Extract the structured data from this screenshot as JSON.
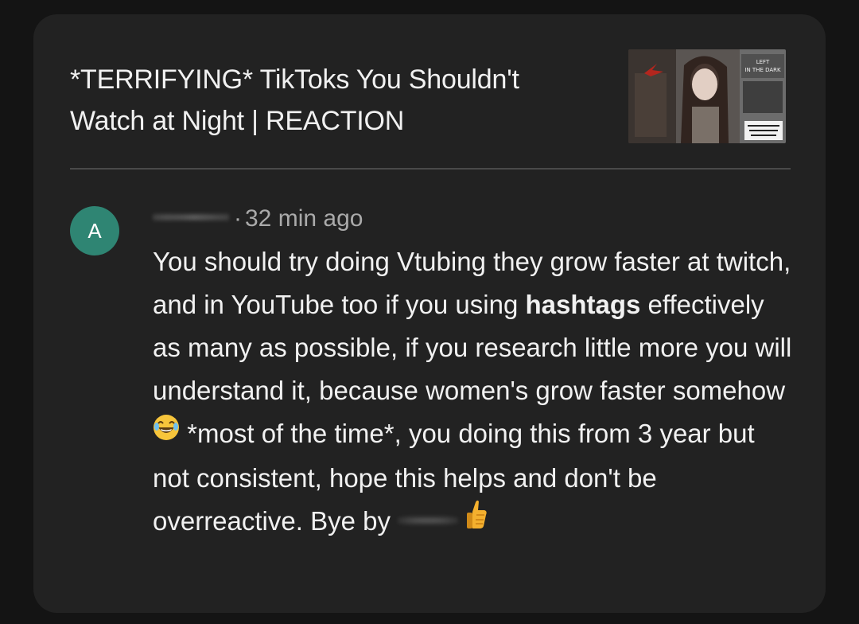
{
  "video": {
    "title_line1": "*TERRIFYING* TikToks You Shouldn't",
    "title_line2": "Watch at Night | REACTION",
    "thumbnail_icon": "video-thumbnail"
  },
  "comment": {
    "avatar_letter": "A",
    "avatar_color": "#2f8573",
    "separator": "·",
    "time": "32 min ago",
    "text_part1": "You should try doing Vtubing they grow faster at twitch, and in YouTube too if you using ",
    "text_bold": "hashtags",
    "text_part2": " effectively as many as possible, if you research little more you will understand it, because women's grow faster somehow",
    "text_part3": " *most of the time*,  you doing this from 3 year but not consistent, hope this helps and don't be overreactive. Bye by ",
    "emoji_1": "laughing-emoji",
    "emoji_2": "thumbs-up-emoji"
  },
  "colors": {
    "card_bg": "#222222",
    "page_bg": "#141414",
    "text": "#f1f1f1",
    "meta_text": "#aaaaaa"
  }
}
